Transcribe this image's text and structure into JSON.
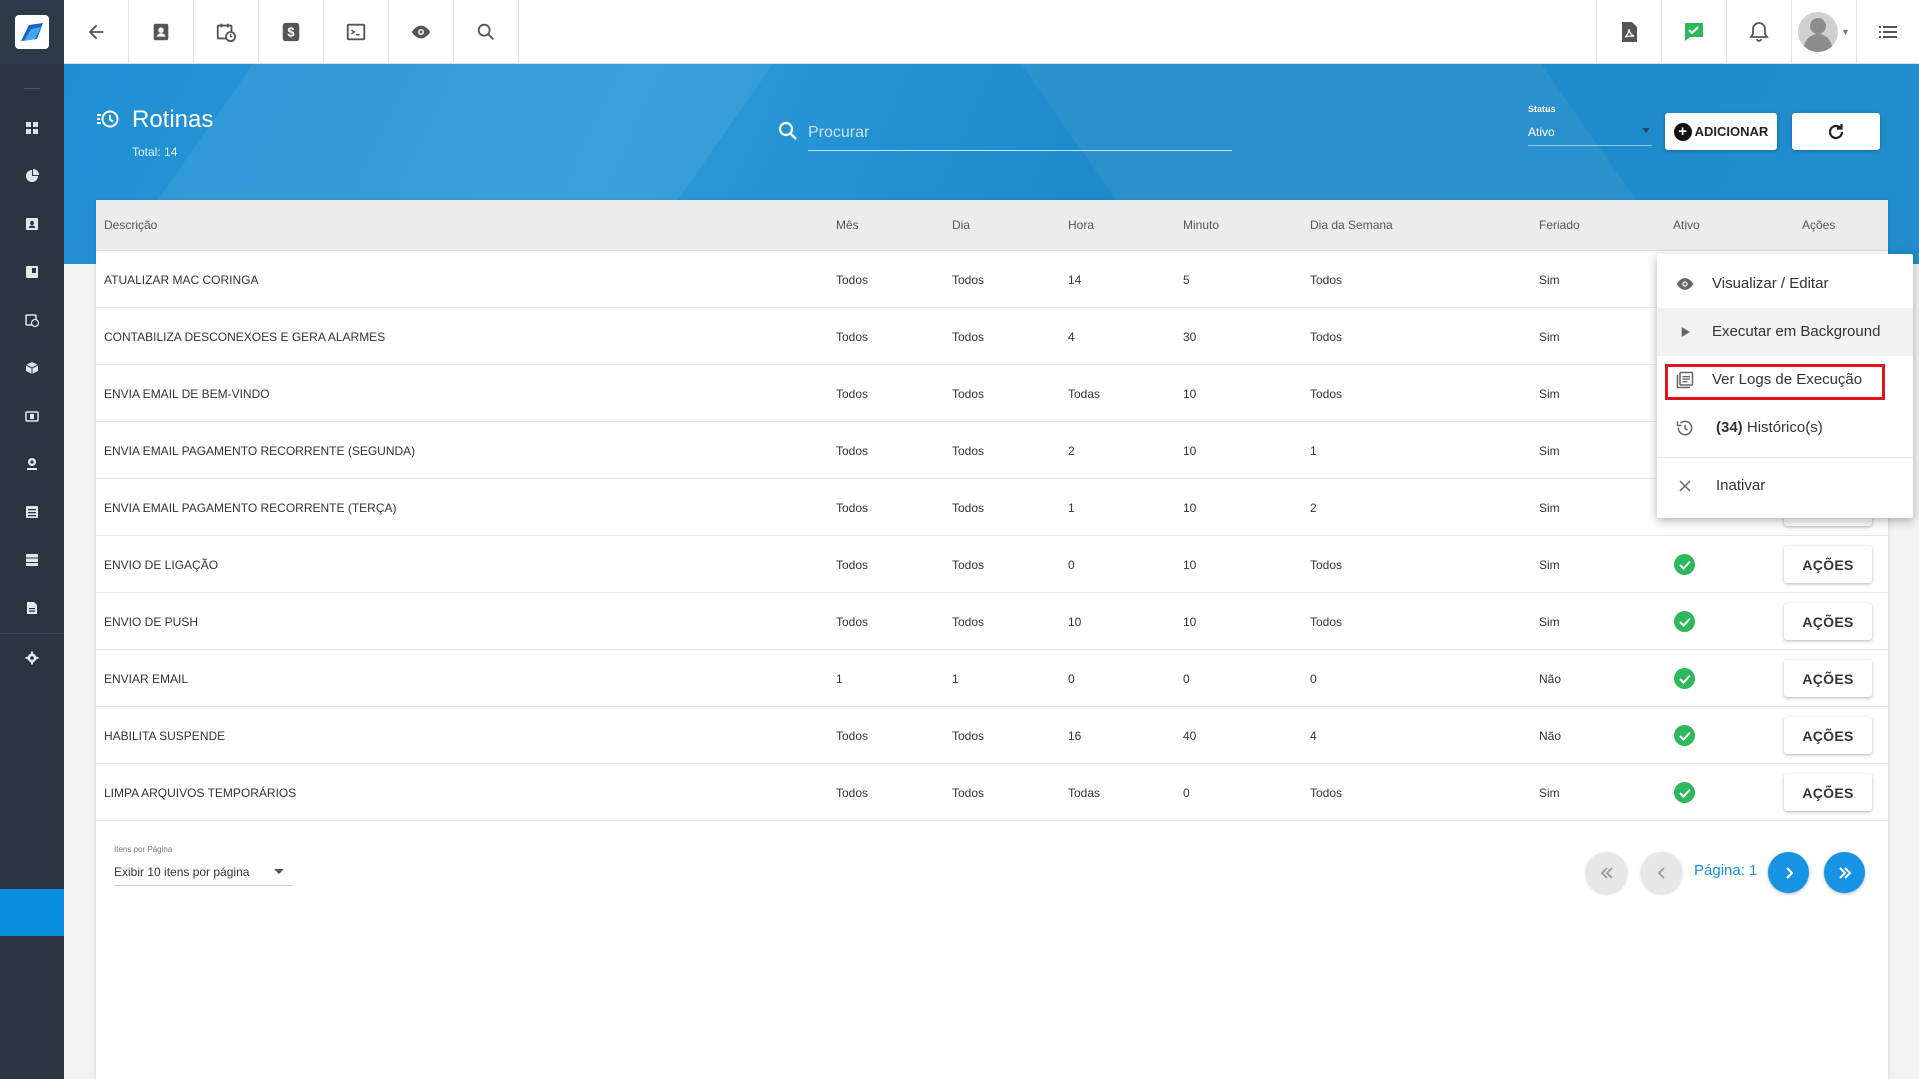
{
  "page": {
    "title": "Rotinas",
    "total": "Total: 14"
  },
  "search": {
    "placeholder": "Procurar"
  },
  "status_filter": {
    "label": "Status",
    "value": "Ativo"
  },
  "buttons": {
    "add": "ADICIONAR"
  },
  "table": {
    "headers": [
      "Descrição",
      "Mês",
      "Dia",
      "Hora",
      "Minuto",
      "Dia da Semana",
      "Feriado",
      "Ativo",
      "Ações"
    ],
    "action_label": "AÇÕES",
    "rows": [
      {
        "descricao": "ATUALIZAR MAC CORINGA",
        "mes": "Todos",
        "dia": "Todos",
        "hora": "14",
        "minuto": "5",
        "dia_semana": "Todos",
        "feriado": "Sim",
        "ativo": true
      },
      {
        "descricao": "CONTABILIZA DESCONEXOES E GERA ALARMES",
        "mes": "Todos",
        "dia": "Todos",
        "hora": "4",
        "minuto": "30",
        "dia_semana": "Todos",
        "feriado": "Sim",
        "ativo": true
      },
      {
        "descricao": "ENVIA EMAIL DE BEM-VINDO",
        "mes": "Todos",
        "dia": "Todos",
        "hora": "Todas",
        "minuto": "10",
        "dia_semana": "Todos",
        "feriado": "Sim",
        "ativo": true
      },
      {
        "descricao": "ENVIA EMAIL PAGAMENTO RECORRENTE (SEGUNDA)",
        "mes": "Todos",
        "dia": "Todos",
        "hora": "2",
        "minuto": "10",
        "dia_semana": "1",
        "feriado": "Sim",
        "ativo": true
      },
      {
        "descricao": "ENVIA EMAIL PAGAMENTO RECORRENTE (TERÇA)",
        "mes": "Todos",
        "dia": "Todos",
        "hora": "1",
        "minuto": "10",
        "dia_semana": "2",
        "feriado": "Sim",
        "ativo": true
      },
      {
        "descricao": "ENVIO DE LIGAÇÃO",
        "mes": "Todos",
        "dia": "Todos",
        "hora": "0",
        "minuto": "10",
        "dia_semana": "Todos",
        "feriado": "Sim",
        "ativo": true
      },
      {
        "descricao": "ENVIO DE PUSH",
        "mes": "Todos",
        "dia": "Todos",
        "hora": "10",
        "minuto": "10",
        "dia_semana": "Todos",
        "feriado": "Sim",
        "ativo": true
      },
      {
        "descricao": "ENVIAR EMAIL",
        "mes": "1",
        "dia": "1",
        "hora": "0",
        "minuto": "0",
        "dia_semana": "0",
        "feriado": "Não",
        "ativo": true
      },
      {
        "descricao": "HABILITA SUSPENDE",
        "mes": "Todos",
        "dia": "Todos",
        "hora": "16",
        "minuto": "40",
        "dia_semana": "4",
        "feriado": "Não",
        "ativo": true
      },
      {
        "descricao": "LIMPA ARQUIVOS TEMPORÁRIOS",
        "mes": "Todos",
        "dia": "Todos",
        "hora": "Todas",
        "minuto": "0",
        "dia_semana": "Todos",
        "feriado": "Sim",
        "ativo": true
      }
    ]
  },
  "pagination": {
    "items_label": "Itens por Página",
    "items_value": "Exibir 10 itens por página",
    "page_text": "Página: 1"
  },
  "actions_menu": {
    "items": [
      {
        "label": "Visualizar / Editar",
        "icon": "eye-icon"
      },
      {
        "label": "Executar em Background",
        "icon": "play-icon"
      },
      {
        "label": "Ver Logs de Execução",
        "icon": "logs-icon"
      },
      {
        "count": "(34)",
        "label": " Histórico(s)",
        "icon": "history-icon"
      },
      {
        "label": "Inativar",
        "icon": "close-icon"
      }
    ]
  },
  "colors": {
    "sidebar": "#2b3440",
    "header_blue": "#1f8fd3",
    "accent": "#1693e3",
    "success": "#2eb85c",
    "highlight": "#e3131b"
  }
}
